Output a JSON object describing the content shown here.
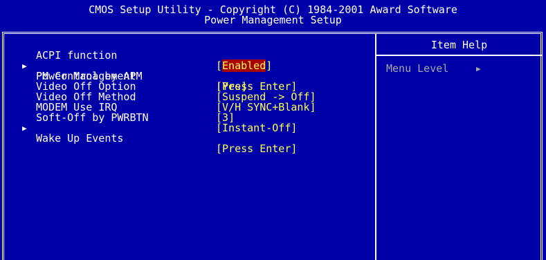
{
  "header": {
    "line1": "CMOS Setup Utility - Copyright (C) 1984-2001 Award Software",
    "line2": "Power Management Setup"
  },
  "items": [
    {
      "label": "ACPI function",
      "value": "Enabled",
      "submenu": false,
      "selected": true
    },
    {
      "label": "Power Management",
      "value": "Press Enter",
      "submenu": true
    },
    {
      "label": "PM Control by APM",
      "value": "Yes",
      "submenu": false
    },
    {
      "label": "Video Off Option",
      "value": "Suspend -> Off",
      "submenu": false
    },
    {
      "label": "Video Off Method",
      "value": "V/H SYNC+Blank",
      "submenu": false
    },
    {
      "label": "MODEM Use IRQ",
      "value": "3",
      "submenu": false
    },
    {
      "label": "Soft-Off by PWRBTN",
      "value": "Instant-Off",
      "submenu": false
    },
    {
      "label": "Wake Up Events",
      "value": "Press Enter",
      "submenu": true
    }
  ],
  "help": {
    "title": "Item Help",
    "menu_level_label": "Menu Level",
    "menu_level_icon": "right-triangle-icon"
  },
  "colors": {
    "background": "#0000a8",
    "label": "#ffffff",
    "value": "#ffff55",
    "selected_bg": "#a80000",
    "help_dim": "#a8a8a8"
  }
}
